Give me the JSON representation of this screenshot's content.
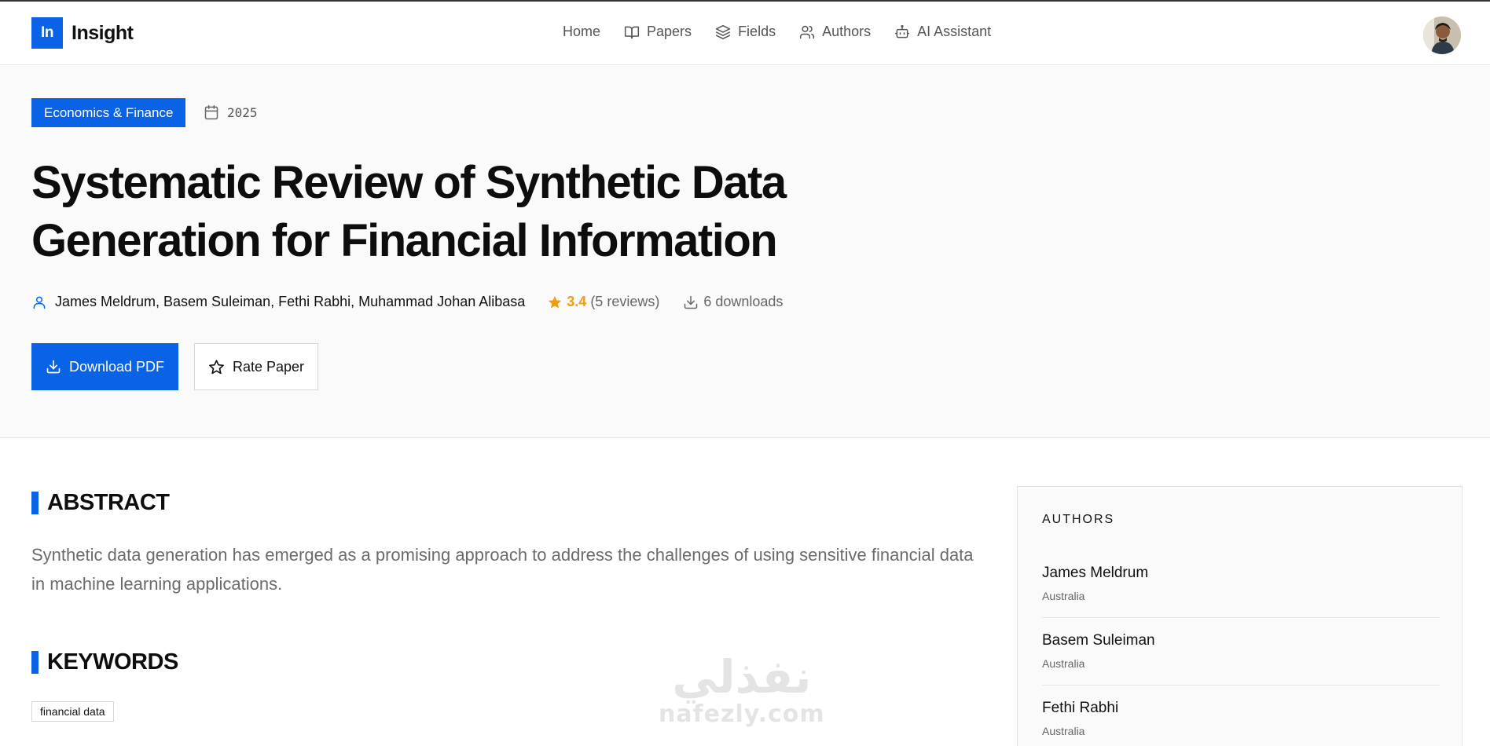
{
  "brand": {
    "mark": "In",
    "name": "Insight"
  },
  "nav": {
    "items": [
      {
        "label": "Home",
        "icon": "none"
      },
      {
        "label": "Papers",
        "icon": "book-open-icon"
      },
      {
        "label": "Fields",
        "icon": "layers-icon"
      },
      {
        "label": "Authors",
        "icon": "users-icon"
      },
      {
        "label": "AI Assistant",
        "icon": "bot-icon"
      }
    ]
  },
  "paper": {
    "field": "Economics & Finance",
    "year": "2025",
    "title": "Systematic Review of Synthetic Data Generation for Financial Information",
    "authors": "James Meldrum, Basem Suleiman, Fethi Rabhi, Muhammad Johan Alibasa",
    "rating": "3.4",
    "reviews": "(5 reviews)",
    "downloads": "6 downloads"
  },
  "actions": {
    "download_label": "Download PDF",
    "rate_label": "Rate Paper"
  },
  "abstract": {
    "heading": "ABSTRACT",
    "text": "Synthetic data generation has emerged as a promising approach to address the challenges of using sensitive financial data in machine learning applications."
  },
  "keywords": {
    "heading": "KEYWORDS",
    "items": [
      "financial data"
    ]
  },
  "sidebar": {
    "title": "AUTHORS",
    "authors": [
      {
        "name": "James Meldrum",
        "country": "Australia"
      },
      {
        "name": "Basem Suleiman",
        "country": "Australia"
      },
      {
        "name": "Fethi Rabhi",
        "country": "Australia"
      }
    ]
  },
  "watermark": {
    "arabic": "نفذلي",
    "latin": "nafezly.com"
  },
  "colors": {
    "accent": "#0a62e6",
    "star": "#f39c12"
  }
}
